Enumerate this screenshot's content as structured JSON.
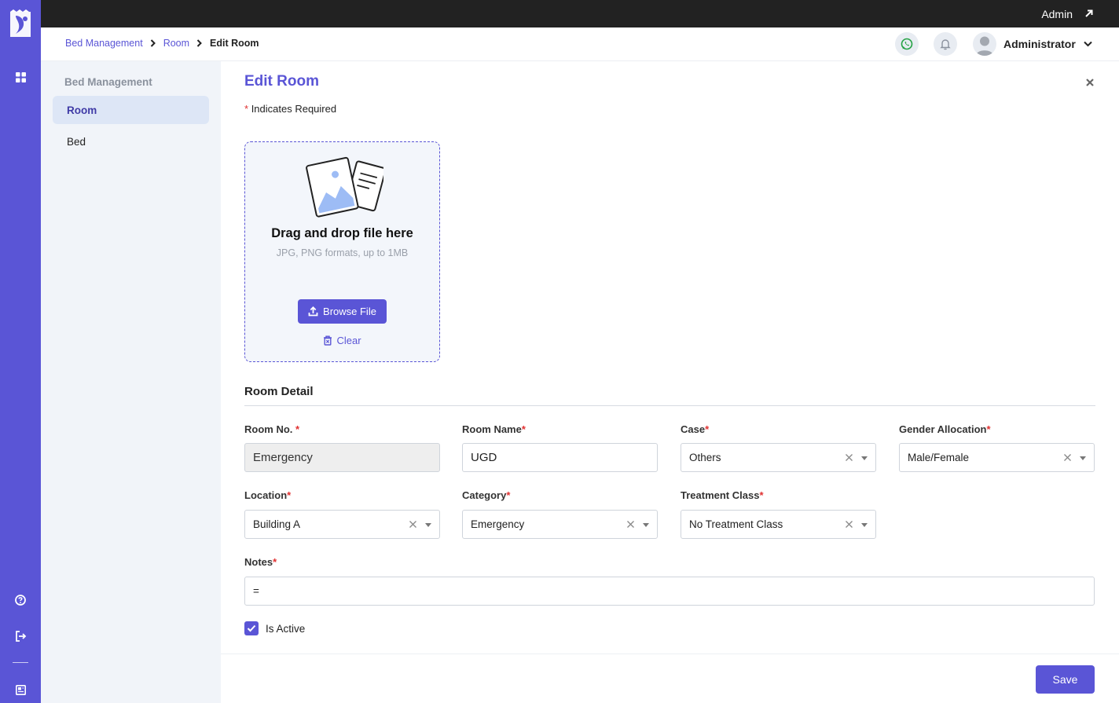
{
  "topbar": {
    "user_label": "Admin"
  },
  "header": {
    "breadcrumbs": [
      "Bed Management",
      "Room",
      "Edit Room"
    ],
    "user_name": "Administrator"
  },
  "sidebar": {
    "title": "Bed Management",
    "items": [
      {
        "label": "Room",
        "active": true
      },
      {
        "label": "Bed",
        "active": false
      }
    ]
  },
  "form": {
    "title": "Edit Room",
    "required_note": "Indicates Required",
    "required_mark": "*",
    "upload": {
      "title": "Drag and drop file here",
      "subtitle": "JPG, PNG formats, up to 1MB",
      "browse_label": "Browse File",
      "clear_label": "Clear"
    },
    "section_title": "Room Detail",
    "fields": {
      "room_no": {
        "label": "Room No.",
        "value": "Emergency"
      },
      "room_name": {
        "label": "Room Name",
        "value": "UGD"
      },
      "case": {
        "label": "Case",
        "value": "Others"
      },
      "gender_allocation": {
        "label": "Gender Allocation",
        "value": "Male/Female"
      },
      "location": {
        "label": "Location",
        "value": "Building A"
      },
      "category": {
        "label": "Category",
        "value": "Emergency"
      },
      "treatment_class": {
        "label": "Treatment Class",
        "value": "No Treatment Class"
      },
      "notes": {
        "label": "Notes",
        "value": "="
      }
    },
    "is_active": {
      "label": "Is Active",
      "checked": true
    },
    "save_label": "Save"
  },
  "colors": {
    "accent": "#5a55d6",
    "topbar": "#222222",
    "required": "#e03131"
  }
}
